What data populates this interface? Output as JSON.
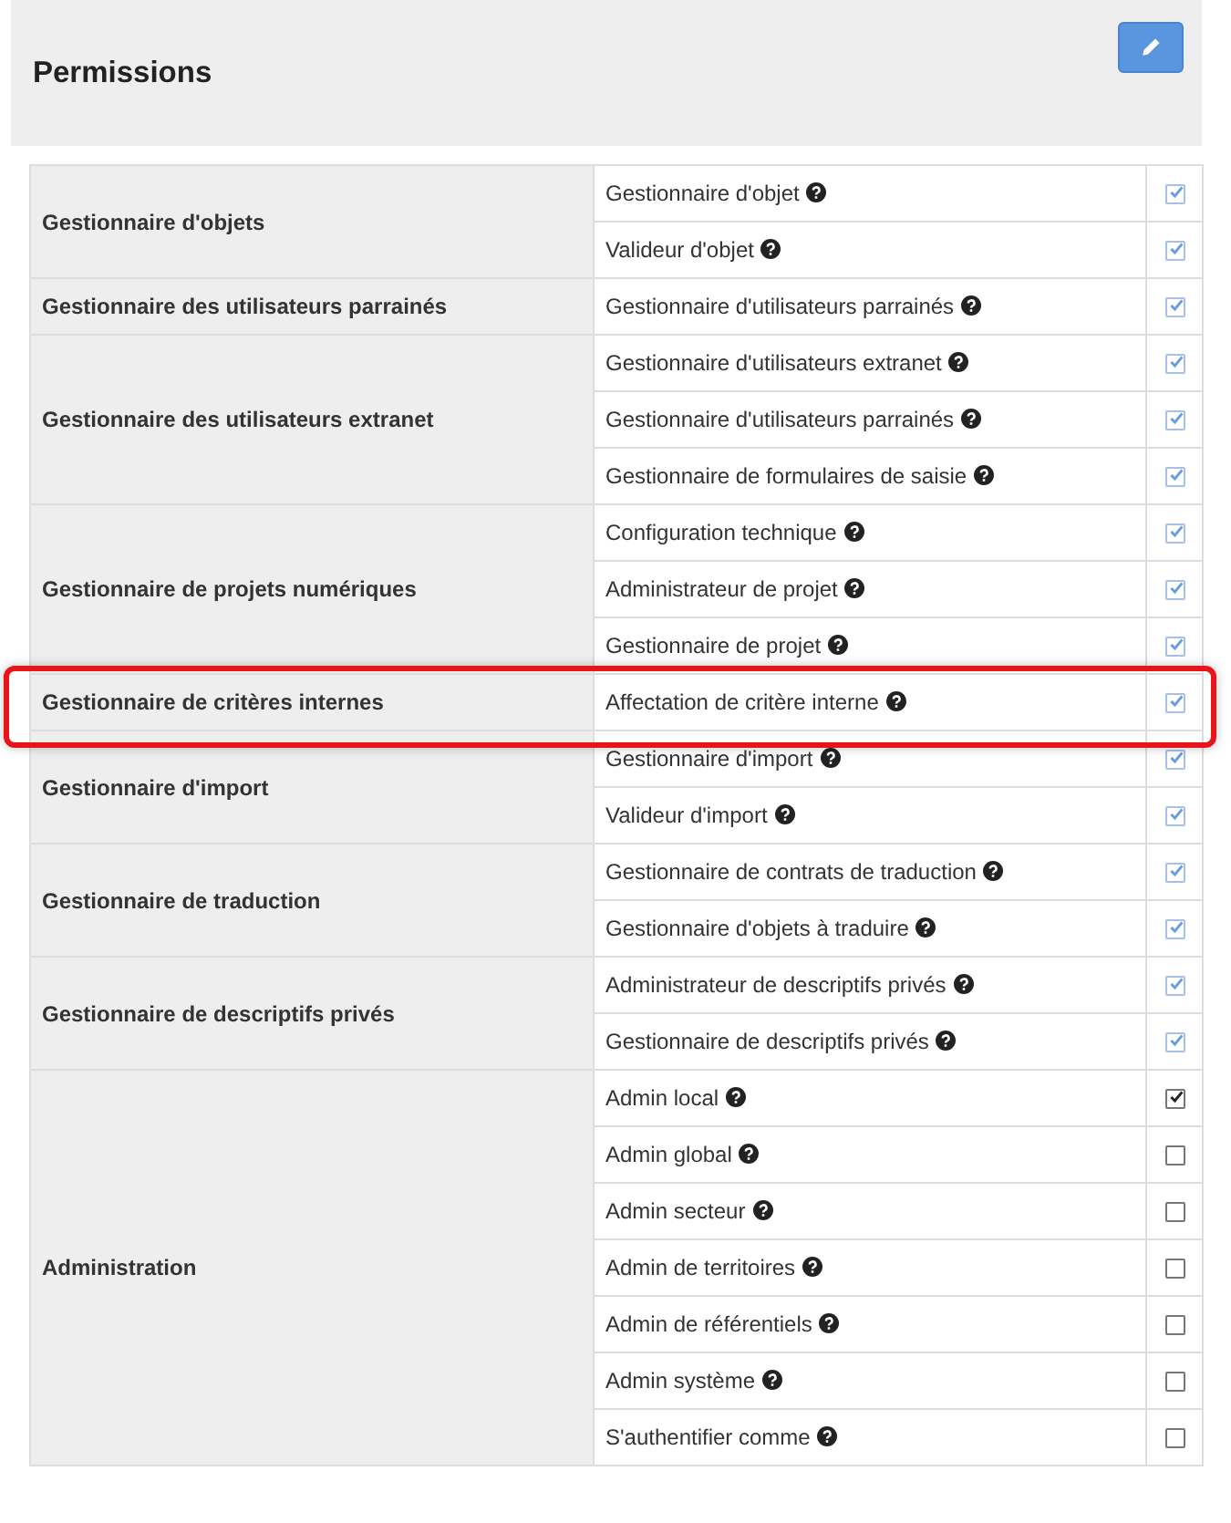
{
  "panel": {
    "title": "Permissions"
  },
  "groups": [
    {
      "name": "Gestionnaire d'objets",
      "highlighted": false,
      "permissions": [
        {
          "label": "Gestionnaire d'objet",
          "checked": true,
          "disabled": true
        },
        {
          "label": "Valideur d'objet",
          "checked": true,
          "disabled": true
        }
      ]
    },
    {
      "name": "Gestionnaire des utilisateurs parrainés",
      "highlighted": false,
      "permissions": [
        {
          "label": "Gestionnaire d'utilisateurs parrainés",
          "checked": true,
          "disabled": true
        }
      ]
    },
    {
      "name": "Gestionnaire des utilisateurs extranet",
      "highlighted": false,
      "permissions": [
        {
          "label": "Gestionnaire d'utilisateurs extranet",
          "checked": true,
          "disabled": true
        },
        {
          "label": "Gestionnaire d'utilisateurs parrainés",
          "checked": true,
          "disabled": true
        },
        {
          "label": "Gestionnaire de formulaires de saisie",
          "checked": true,
          "disabled": true
        }
      ]
    },
    {
      "name": "Gestionnaire de projets numériques",
      "highlighted": false,
      "permissions": [
        {
          "label": "Configuration technique",
          "checked": true,
          "disabled": true
        },
        {
          "label": "Administrateur de projet",
          "checked": true,
          "disabled": true
        },
        {
          "label": "Gestionnaire de projet",
          "checked": true,
          "disabled": true
        }
      ]
    },
    {
      "name": "Gestionnaire de critères internes",
      "highlighted": true,
      "permissions": [
        {
          "label": "Affectation de critère interne",
          "checked": true,
          "disabled": true
        }
      ]
    },
    {
      "name": "Gestionnaire d'import",
      "highlighted": false,
      "permissions": [
        {
          "label": "Gestionnaire d'import",
          "checked": true,
          "disabled": true
        },
        {
          "label": "Valideur d'import",
          "checked": true,
          "disabled": true
        }
      ]
    },
    {
      "name": "Gestionnaire de traduction",
      "highlighted": false,
      "permissions": [
        {
          "label": "Gestionnaire de contrats de traduction",
          "checked": true,
          "disabled": true
        },
        {
          "label": "Gestionnaire d'objets à traduire",
          "checked": true,
          "disabled": true
        }
      ]
    },
    {
      "name": "Gestionnaire de descriptifs privés",
      "highlighted": false,
      "permissions": [
        {
          "label": "Administrateur de descriptifs privés",
          "checked": true,
          "disabled": true
        },
        {
          "label": "Gestionnaire de descriptifs privés",
          "checked": true,
          "disabled": true
        }
      ]
    },
    {
      "name": "Administration",
      "highlighted": false,
      "permissions": [
        {
          "label": "Admin local",
          "checked": true,
          "disabled": false
        },
        {
          "label": "Admin global",
          "checked": false,
          "disabled": false
        },
        {
          "label": "Admin secteur",
          "checked": false,
          "disabled": false
        },
        {
          "label": "Admin de territoires",
          "checked": false,
          "disabled": false
        },
        {
          "label": "Admin de référentiels",
          "checked": false,
          "disabled": false
        },
        {
          "label": "Admin système",
          "checked": false,
          "disabled": false
        },
        {
          "label": "S'authentifier comme",
          "checked": false,
          "disabled": false
        }
      ]
    }
  ]
}
